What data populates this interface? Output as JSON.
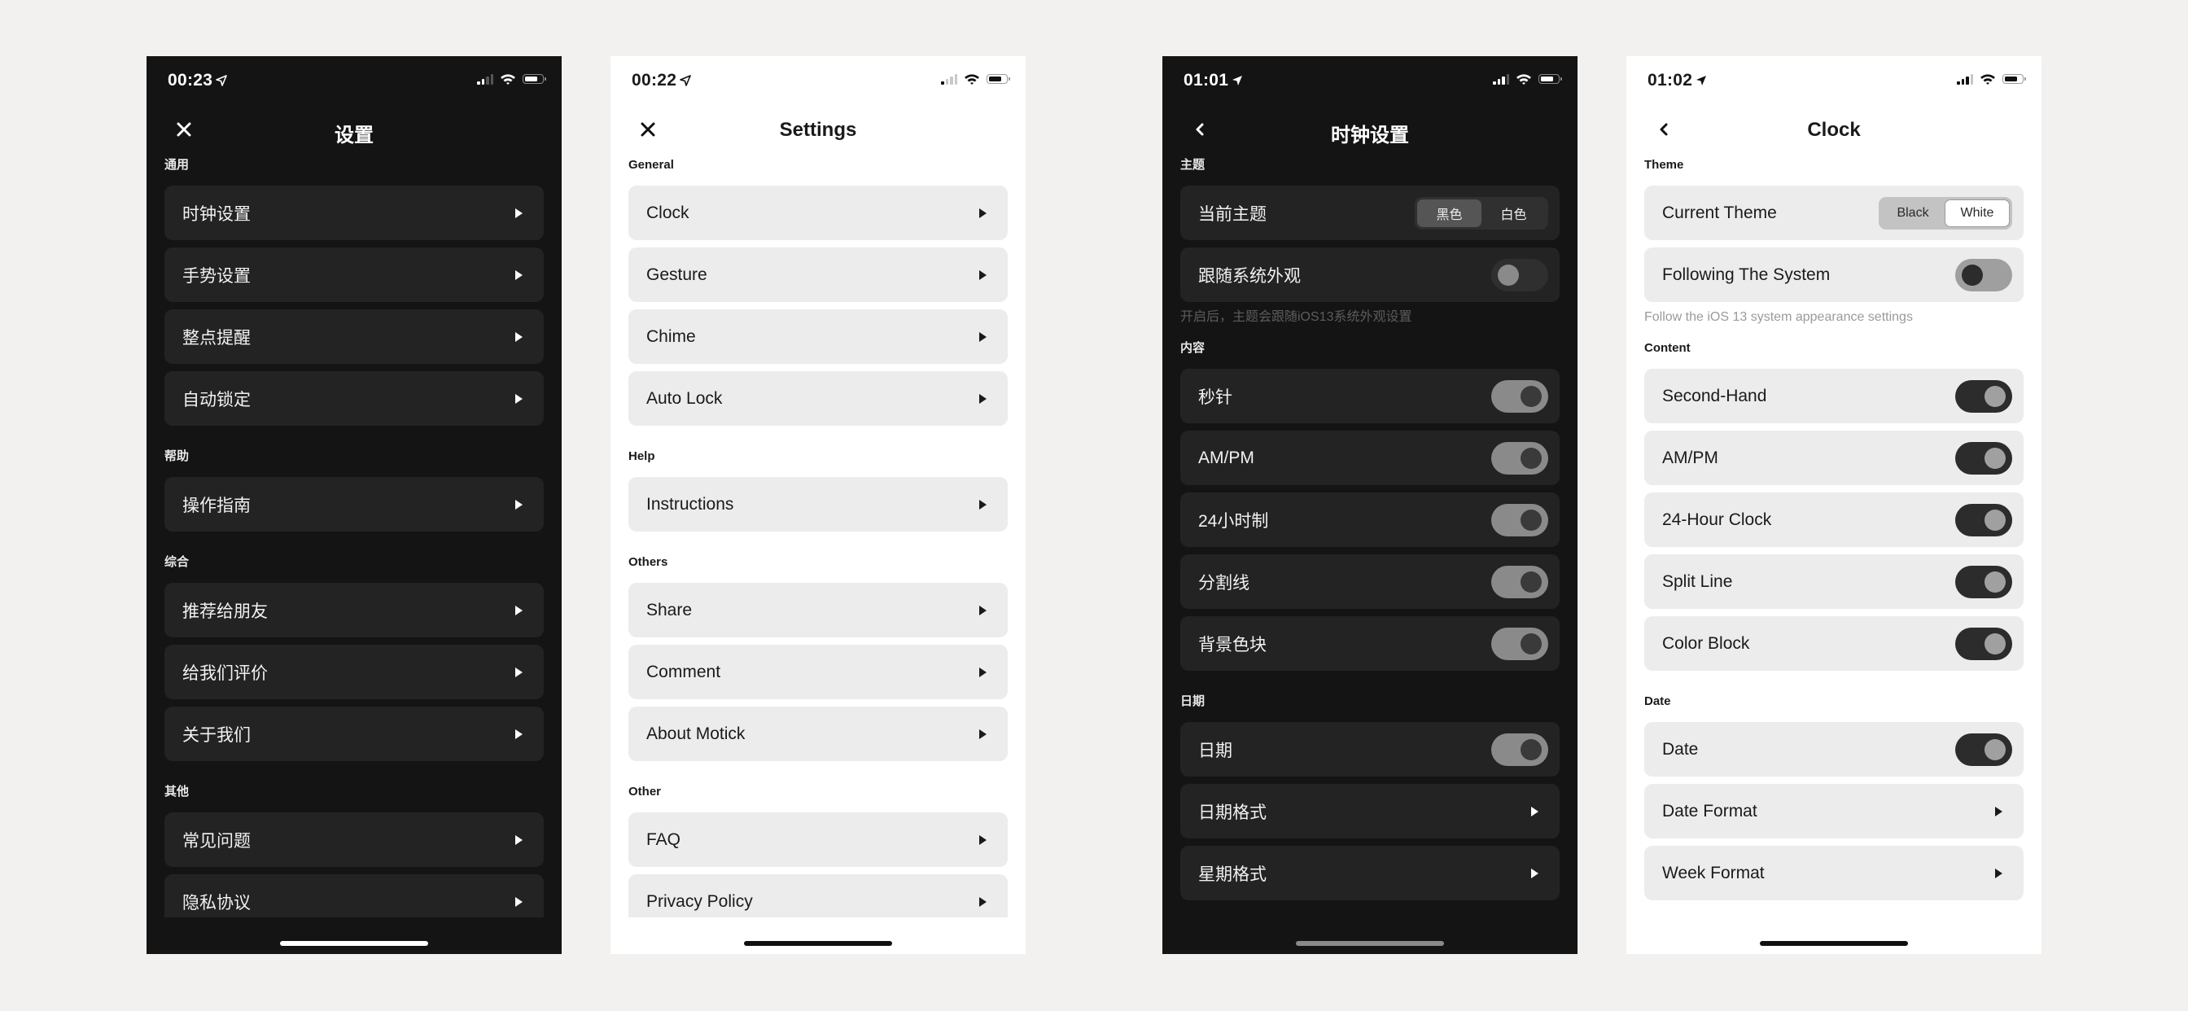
{
  "phones": [
    {
      "theme": "dark",
      "status": {
        "time": "00:23",
        "signal_bars": 2,
        "signal_total": 4
      },
      "nav": {
        "left_icon": "close-icon",
        "title": "设置"
      },
      "sections": [
        {
          "title": "通用",
          "items": [
            {
              "label": "时钟设置"
            },
            {
              "label": "手势设置"
            },
            {
              "label": "整点提醒"
            },
            {
              "label": "自动锁定"
            }
          ]
        },
        {
          "title": "帮助",
          "items": [
            {
              "label": "操作指南"
            }
          ]
        },
        {
          "title": "综合",
          "items": [
            {
              "label": "推荐给朋友"
            },
            {
              "label": "给我们评价"
            },
            {
              "label": "关于我们"
            }
          ]
        },
        {
          "title": "其他",
          "items": [
            {
              "label": "常见问题"
            },
            {
              "label": "隐私协议"
            }
          ]
        }
      ]
    },
    {
      "theme": "light",
      "status": {
        "time": "00:22",
        "signal_bars": 1,
        "signal_total": 4
      },
      "nav": {
        "left_icon": "close-icon",
        "title": "Settings"
      },
      "sections": [
        {
          "title": "General",
          "items": [
            {
              "label": "Clock"
            },
            {
              "label": "Gesture"
            },
            {
              "label": "Chime"
            },
            {
              "label": "Auto Lock"
            }
          ]
        },
        {
          "title": "Help",
          "items": [
            {
              "label": "Instructions"
            }
          ]
        },
        {
          "title": "Others",
          "items": [
            {
              "label": "Share"
            },
            {
              "label": "Comment"
            },
            {
              "label": "About Motick"
            }
          ]
        },
        {
          "title": "Other",
          "items": [
            {
              "label": "FAQ"
            },
            {
              "label": "Privacy Policy"
            }
          ]
        }
      ]
    },
    {
      "theme": "dark",
      "status": {
        "time": "01:01",
        "signal_bars": 3,
        "signal_total": 4
      },
      "nav": {
        "left_icon": "back-chevron-icon",
        "title": "时钟设置"
      },
      "theme_section": {
        "title": "主题",
        "current_theme_label": "当前主题",
        "segments": [
          "黑色",
          "白色"
        ],
        "selected_segment": 0,
        "follow_system_label": "跟随系统外观",
        "follow_system_on": false,
        "caption": "开启后，主题会跟随iOS13系统外观设置"
      },
      "content_section": {
        "title": "内容",
        "items": [
          {
            "label": "秒针",
            "on": true
          },
          {
            "label": "AM/PM",
            "on": true
          },
          {
            "label": "24小时制",
            "on": true
          },
          {
            "label": "分割线",
            "on": true
          },
          {
            "label": "背景色块",
            "on": true
          }
        ]
      },
      "date_section": {
        "title": "日期",
        "toggle_item": {
          "label": "日期",
          "on": true
        },
        "nav_items": [
          {
            "label": "日期格式"
          },
          {
            "label": "星期格式"
          }
        ]
      }
    },
    {
      "theme": "light",
      "status": {
        "time": "01:02",
        "signal_bars": 3,
        "signal_total": 4
      },
      "nav": {
        "left_icon": "back-chevron-icon",
        "title": "Clock"
      },
      "theme_section": {
        "title": "Theme",
        "current_theme_label": "Current Theme",
        "segments": [
          "Black",
          "White"
        ],
        "selected_segment": 1,
        "follow_system_label": "Following The System",
        "follow_system_on": false,
        "caption": "Follow the iOS 13 system appearance settings"
      },
      "content_section": {
        "title": "Content",
        "items": [
          {
            "label": "Second-Hand",
            "on": true
          },
          {
            "label": "AM/PM",
            "on": true
          },
          {
            "label": "24-Hour Clock",
            "on": true
          },
          {
            "label": "Split Line",
            "on": true
          },
          {
            "label": "Color Block",
            "on": true
          }
        ]
      },
      "date_section": {
        "title": "Date",
        "toggle_item": {
          "label": "Date",
          "on": true
        },
        "nav_items": [
          {
            "label": "Date Format"
          },
          {
            "label": "Week Format"
          }
        ]
      }
    }
  ]
}
